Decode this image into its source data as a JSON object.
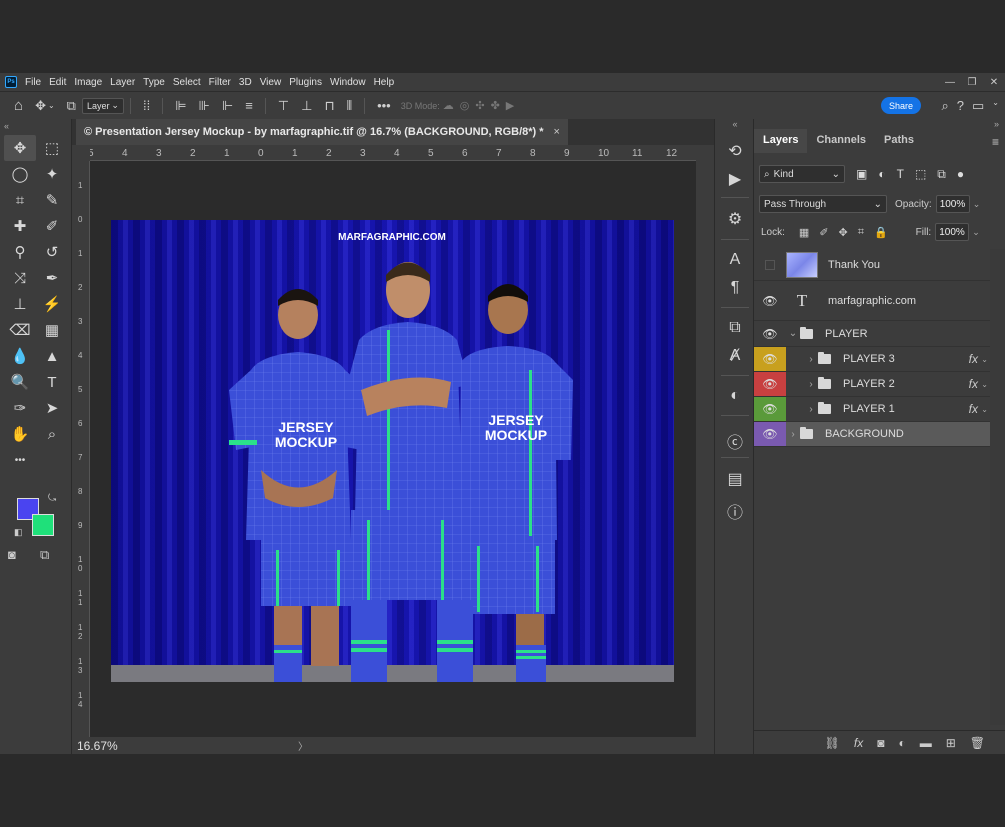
{
  "app": {
    "menu": [
      "File",
      "Edit",
      "Image",
      "Layer",
      "Type",
      "Select",
      "Filter",
      "3D",
      "View",
      "Plugins",
      "Window",
      "Help"
    ],
    "logo_text": "Ps",
    "window_controls": [
      "—",
      "❐",
      "✕"
    ]
  },
  "options_bar": {
    "layer_select": "Layer",
    "mode_3d_label": "3D Mode:",
    "share_label": "Share"
  },
  "toolbar": {
    "collapse_glyph": "«",
    "tools": [
      {
        "name": "move-tool-icon",
        "glyph": "✥",
        "active": true
      },
      {
        "name": "marquee-tool-icon",
        "glyph": "⬚",
        "active": false
      },
      {
        "name": "lasso-tool-icon",
        "glyph": "◯",
        "active": false
      },
      {
        "name": "magic-wand-tool-icon",
        "glyph": "✦",
        "active": false
      },
      {
        "name": "crop-tool-icon",
        "glyph": "⌗",
        "active": false
      },
      {
        "name": "eyedropper-tool-icon",
        "glyph": "✎",
        "active": false
      },
      {
        "name": "healing-brush-tool-icon",
        "glyph": "✚",
        "active": false
      },
      {
        "name": "brush-tool-icon",
        "glyph": "✐",
        "active": false
      },
      {
        "name": "clone-stamp-tool-icon",
        "glyph": "⚲",
        "active": false
      },
      {
        "name": "history-brush-tool-icon",
        "glyph": "↺",
        "active": false
      },
      {
        "name": "content-aware-move-icon",
        "glyph": "⤨",
        "active": false
      },
      {
        "name": "brush-alt-tool-icon",
        "glyph": "✒",
        "active": false
      },
      {
        "name": "stamp-tool-icon",
        "glyph": "⊥",
        "active": false
      },
      {
        "name": "mixer-brush-tool-icon",
        "glyph": "⚡",
        "active": false
      },
      {
        "name": "eraser-tool-icon",
        "glyph": "⌫",
        "active": false
      },
      {
        "name": "gradient-tool-icon",
        "glyph": "▦",
        "active": false
      },
      {
        "name": "blur-tool-icon",
        "glyph": "💧",
        "active": false
      },
      {
        "name": "sharpen-tool-icon",
        "glyph": "▲",
        "active": false
      },
      {
        "name": "dodge-tool-icon",
        "glyph": "🔍",
        "active": false
      },
      {
        "name": "type-tool-icon",
        "glyph": "T",
        "active": false
      },
      {
        "name": "pen-tool-icon",
        "glyph": "✑",
        "active": false
      },
      {
        "name": "path-selection-tool-icon",
        "glyph": "➤",
        "active": false
      },
      {
        "name": "hand-tool-icon",
        "glyph": "✋",
        "active": false
      },
      {
        "name": "zoom-tool-icon",
        "glyph": "⌕",
        "active": false
      },
      {
        "name": "more-tools-icon",
        "glyph": "•••",
        "active": false
      }
    ],
    "foreground_color": "#4a44f0",
    "background_color": "#1fe07a"
  },
  "document": {
    "tab_title": "© Presentation Jersey Mockup - by marfagraphic.tif @ 16.7% (BACKGROUND, RGB/8*) *",
    "close_glyph": "×",
    "zoom": "16.67%",
    "status_arrow": "〉",
    "ruler_h": [
      "5",
      "4",
      "3",
      "2",
      "1",
      "0",
      "1",
      "2",
      "3",
      "4",
      "5",
      "6",
      "7",
      "8",
      "9",
      "10",
      "11",
      "12"
    ],
    "ruler_v": [
      "1",
      "0",
      "1",
      "2",
      "3",
      "4",
      "5",
      "6",
      "7",
      "8",
      "9",
      "1 0",
      "1 1",
      "1 2",
      "1 3",
      "1 4"
    ],
    "canvas": {
      "watermark": "MARFAGRAPHIC.COM",
      "jersey_text": "JERSEY MOCKUP",
      "curtain_color": "#1412a8",
      "jersey_color": "#3b4fd8",
      "trim_color": "#2be08a"
    }
  },
  "layers_panel": {
    "tabs": [
      "Layers",
      "Channels",
      "Paths"
    ],
    "filter_kind": "Kind",
    "blend_mode": "Pass Through",
    "opacity_label": "Opacity:",
    "opacity_value": "100%",
    "lock_label": "Lock:",
    "fill_label": "Fill:",
    "fill_value": "100%",
    "layers": [
      {
        "name": "Thank You",
        "type": "image",
        "visible": false,
        "indent": 0,
        "label_color": ""
      },
      {
        "name": "marfagraphic.com",
        "type": "text",
        "visible": true,
        "indent": 0,
        "label_color": ""
      },
      {
        "name": "PLAYER",
        "type": "group",
        "visible": true,
        "indent": 0,
        "label_color": "",
        "expanded": true
      },
      {
        "name": "PLAYER 3",
        "type": "group",
        "visible": true,
        "indent": 1,
        "label_color": "#c8a01e",
        "fx": true
      },
      {
        "name": "PLAYER 2",
        "type": "group",
        "visible": true,
        "indent": 1,
        "label_color": "#c84040",
        "fx": true
      },
      {
        "name": "PLAYER 1",
        "type": "group",
        "visible": true,
        "indent": 1,
        "label_color": "#5a9a3a",
        "fx": true
      },
      {
        "name": "BACKGROUND",
        "type": "group",
        "visible": true,
        "indent": 0,
        "label_color": "#7a5ab0",
        "selected": true
      }
    ],
    "fx_label": "fx"
  }
}
